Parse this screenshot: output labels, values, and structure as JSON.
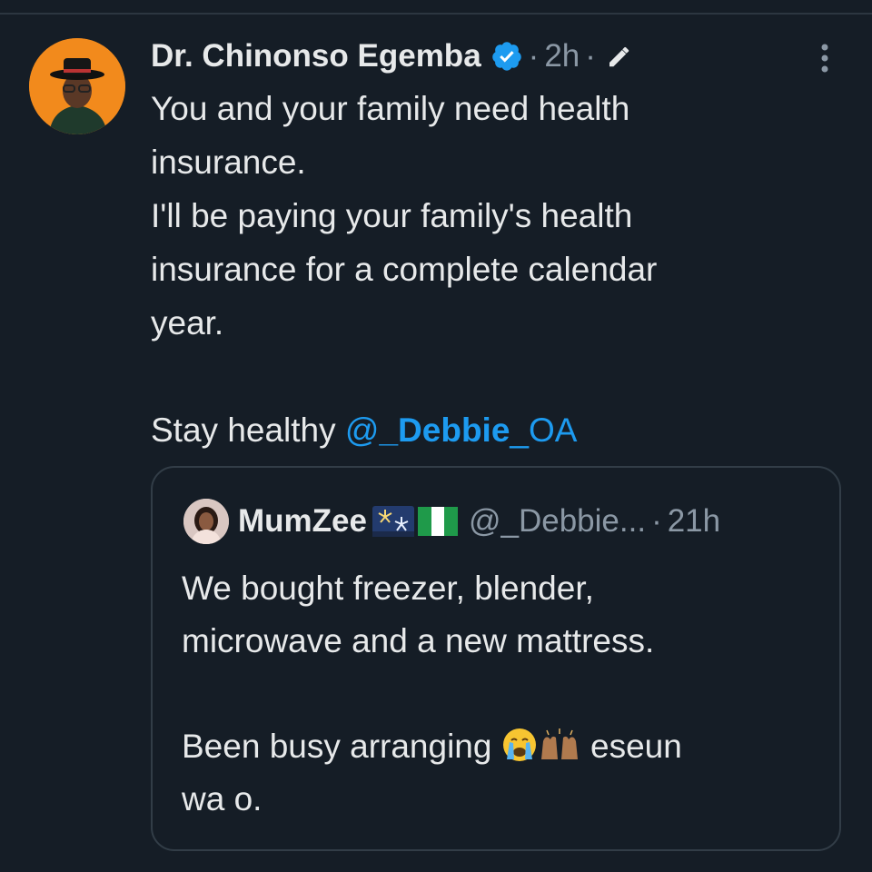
{
  "tweet": {
    "display_name": "Dr. Chinonso Egemba",
    "separator": "·",
    "time": "2h",
    "lines": [
      "You and your family need health",
      "insurance.",
      "I'll be paying your family's health",
      "insurance for a complete calendar",
      "year."
    ],
    "closing_text": "Stay healthy ",
    "mention_prefix": "@",
    "mention_bold": "_Debbie",
    "mention_suffix": "_OA",
    "icons": {
      "verified": "verified-badge-icon",
      "edit": "edited-pencil-icon",
      "more": "more-options-icon"
    }
  },
  "quote": {
    "display_name": "MumZee",
    "handle": "@_Debbie...",
    "separator": "·",
    "time": "21h",
    "lines": [
      "We bought freezer, blender,",
      "microwave and a new mattress."
    ],
    "closing_line_1": "Been busy arranging ",
    "closing_after_emoji": " eseun",
    "closing_line_2": "wa o.",
    "icons": {
      "fireworks": "fireworks-emoji",
      "flag": "nigeria-flag-emoji",
      "crying": "crying-face-emoji",
      "hands": "raising-hands-emoji"
    }
  },
  "colors": {
    "background": "#151d26",
    "text": "#e7e9ea",
    "muted": "#8b98a5",
    "link": "#1d9bf0",
    "verified": "#1d9bf0",
    "border": "#323d47"
  }
}
